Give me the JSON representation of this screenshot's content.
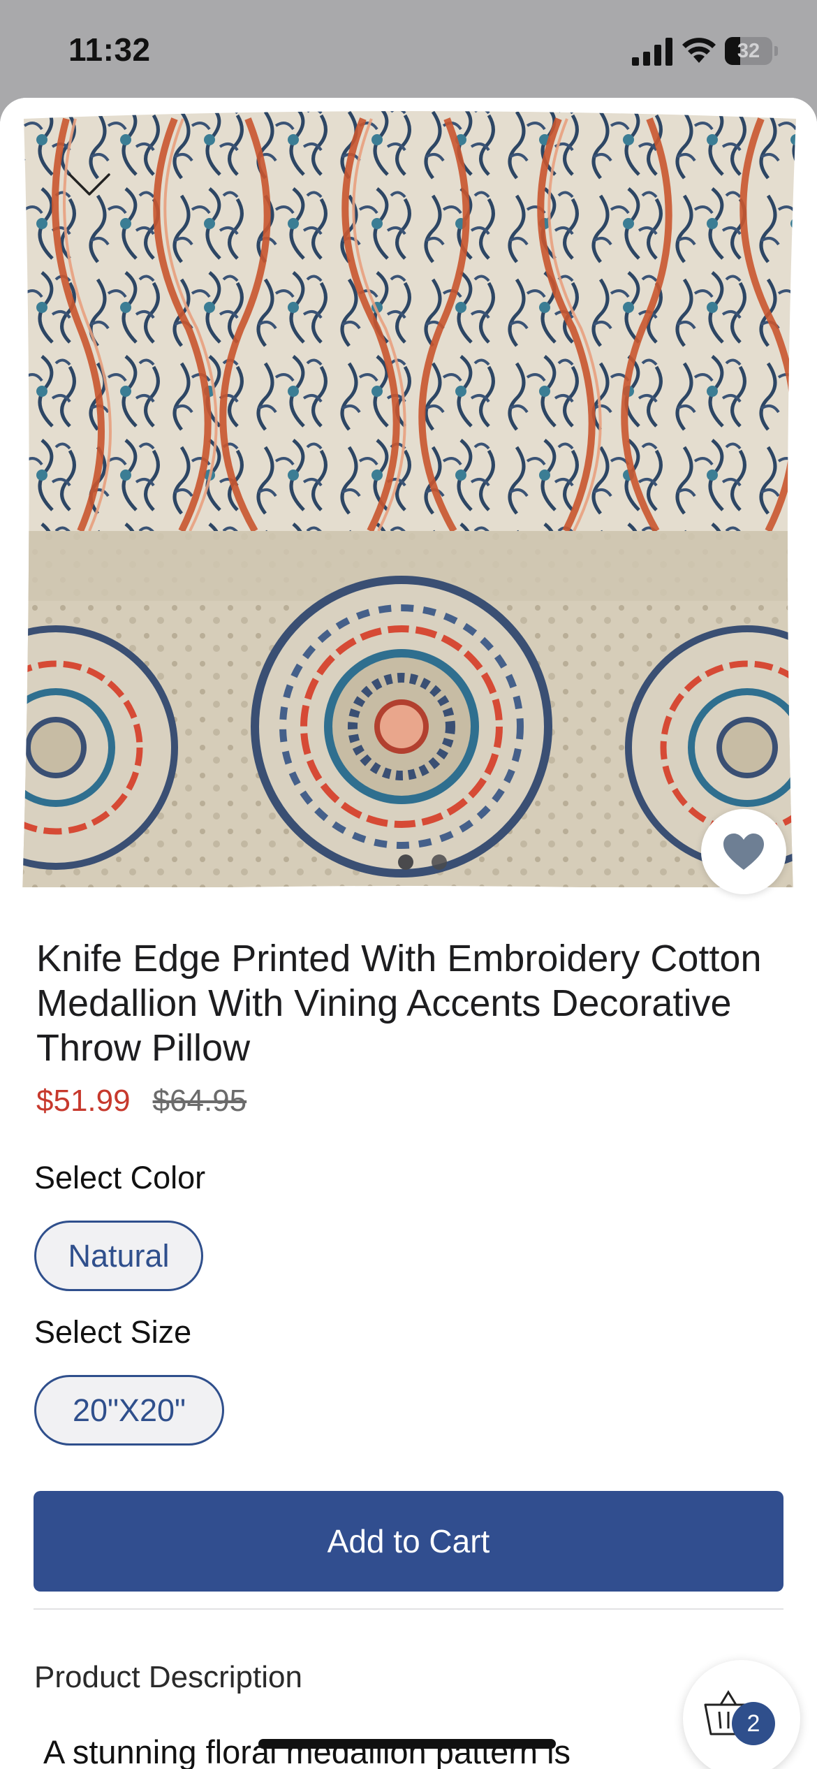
{
  "status_bar": {
    "time": "11:32",
    "battery_level": "32",
    "battery_fraction": 0.32,
    "icons": [
      "signal-icon",
      "wifi-icon",
      "battery-icon"
    ]
  },
  "product": {
    "title": "Knife Edge Printed With Embroidery Cotton Medallion With Vining Accents Decorative Throw Pillow",
    "sale_price": "$51.99",
    "original_price": "$64.95",
    "image_count": 2,
    "active_image_index": 0
  },
  "options": {
    "color_label": "Select Color",
    "color_value": "Natural",
    "size_label": "Select Size",
    "size_value": "20\"X20\""
  },
  "actions": {
    "add_to_cart": "Add to Cart"
  },
  "description": {
    "header": "Product Description",
    "text_preview": "A stunning floral medallion pattern is"
  },
  "cart": {
    "count": "2"
  },
  "colors": {
    "accent": "#314e8f",
    "sale_price": "#c7392d",
    "heart": "#6e7f94"
  },
  "icons": {
    "collapse": "chevron-down-icon",
    "favorite": "heart-icon",
    "cart": "basket-icon",
    "description_toggle": "chevron-up-icon"
  }
}
